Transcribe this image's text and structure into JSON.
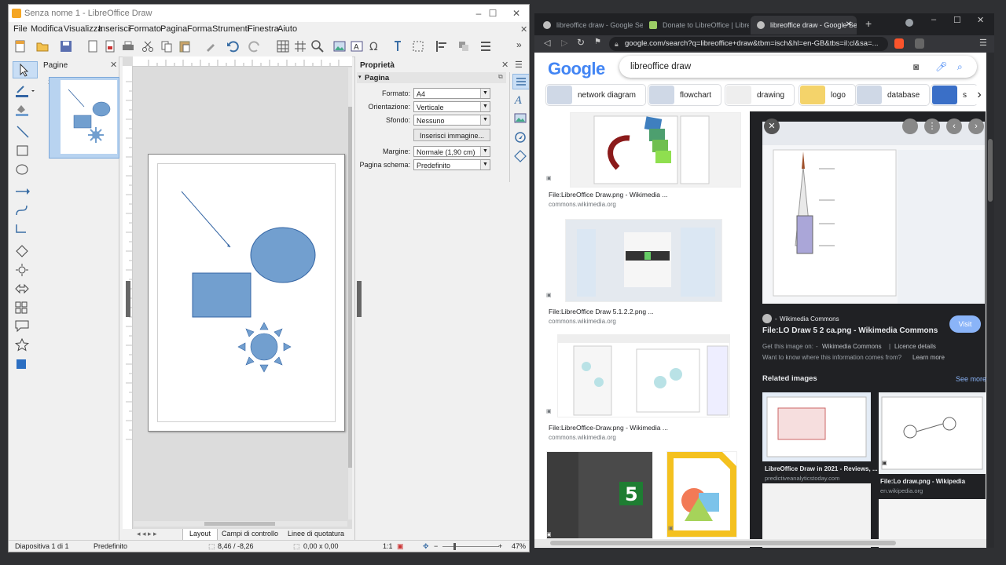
{
  "lo": {
    "title": "Senza nome 1 - LibreOffice Draw",
    "menu": [
      "File",
      "Modifica",
      "Visualizza",
      "Inserisci",
      "Formato",
      "Pagina",
      "Forma",
      "Strumenti",
      "Finestra",
      "Aiuto"
    ],
    "pages_title": "Pagine",
    "page_number": "1",
    "props_title": "Proprietà",
    "section_title": "Pagina",
    "props": {
      "formato_label": "Formato:",
      "formato_value": "A4",
      "orient_label": "Orientazione:",
      "orient_value": "Verticale",
      "sfondo_label": "Sfondo:",
      "sfondo_value": "Nessuno",
      "insert_image": "Inserisci immagine...",
      "margini_label": "Margine:",
      "margini_value": "Normale (1,90 cm)",
      "schema_label": "Pagina schema:",
      "schema_value": "Predefinito"
    },
    "tabs": [
      "Layout",
      "Campi di controllo",
      "Linee di quotatura"
    ],
    "status": {
      "slide": "Diapositiva 1 di 1",
      "style": "Predefinito",
      "pos": "8,46 / -8,26",
      "size": "0,00 x 0,00",
      "ratio": "1:1",
      "zoom": "47%"
    },
    "shape_color": "#729fcf",
    "shape_stroke": "#3465a4"
  },
  "browser": {
    "tabs": [
      {
        "title": "libreoffice draw - Google Search"
      },
      {
        "title": "Donate to LibreOffice | LibreOffice"
      },
      {
        "title": "libreoffice draw - Google Search"
      }
    ],
    "url": "google.com/search?q=libreoffice+draw&tbm=isch&hl=en-GB&tbs=il:cl&sa=...",
    "logo": "Google",
    "search_value": "libreoffice draw",
    "chips": [
      "network diagram",
      "flowchart",
      "drawing",
      "logo",
      "database",
      "s"
    ],
    "results": [
      {
        "caption": "File:LibreOffice Draw.png - Wikimedia ...",
        "source": "commons.wikimedia.org"
      },
      {
        "caption": "File:LibreOffice Draw 5.1.2.2.png ...",
        "source": "commons.wikimedia.org"
      },
      {
        "caption": "File:LibreOffice-Draw.png - Wikimedia ...",
        "source": "commons.wikimedia.org"
      }
    ],
    "panel": {
      "site": "Wikimedia Commons",
      "title": "File:LO Draw 5 2 ca.png - Wikimedia Commons",
      "visit": "Visit",
      "get_image_prefix": "Get this image on:",
      "get_image_site": "Wikimedia Commons",
      "licence": "Licence details",
      "want_to_know": "Want to know where this information comes from?",
      "learn_more": "Learn more",
      "related": "Related images",
      "see_more": "See more",
      "related_items": [
        {
          "caption": "LibreOffice Draw in 2021 - Reviews, ...",
          "source": "predictiveanalyticstoday.com"
        },
        {
          "caption": "File:Lo draw.png - Wikipedia",
          "source": "en.wikipedia.org"
        }
      ]
    }
  }
}
